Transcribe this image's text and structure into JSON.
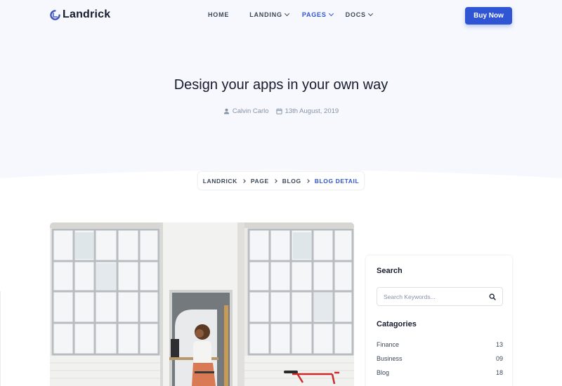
{
  "brand": {
    "name": "Landrick",
    "accent": "#2f55d4",
    "logo_icon": "landrick-logo-icon"
  },
  "nav": {
    "items": [
      {
        "label": "HOME",
        "has_dropdown": false,
        "active": false
      },
      {
        "label": "LANDING",
        "has_dropdown": true,
        "active": false
      },
      {
        "label": "PAGES",
        "has_dropdown": true,
        "active": true
      },
      {
        "label": "DOCS",
        "has_dropdown": true,
        "active": false
      }
    ],
    "cta_label": "Buy Now"
  },
  "hero": {
    "title": "Design your apps in your own way",
    "author": "Calvin Carlo",
    "author_icon": "user-icon",
    "date": "13th August, 2019",
    "date_icon": "calendar-icon"
  },
  "breadcrumb": {
    "items": [
      "LANDRICK",
      "PAGE",
      "BLOG",
      "BLOG DETAIL"
    ]
  },
  "sidebar": {
    "search": {
      "title": "Search",
      "placeholder": "Search Keywords...",
      "icon": "search-icon"
    },
    "categories": {
      "title": "Catagories",
      "items": [
        {
          "name": "Finance",
          "count": "13"
        },
        {
          "name": "Business",
          "count": "09"
        },
        {
          "name": "Blog",
          "count": "18"
        }
      ]
    }
  }
}
